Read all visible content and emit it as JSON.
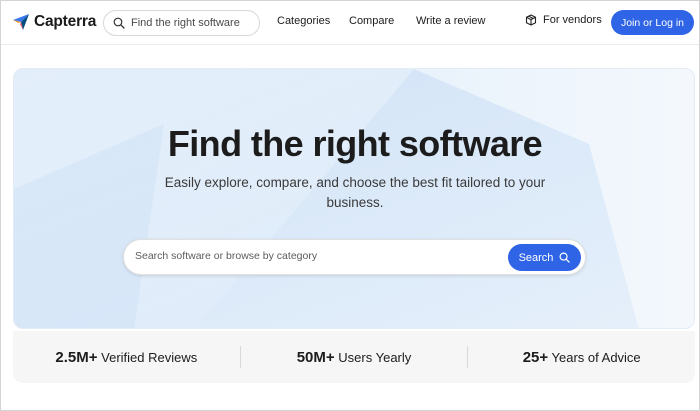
{
  "header": {
    "logo_text": "Capterra",
    "search_placeholder": "Find the right software",
    "nav": [
      "Categories",
      "Compare",
      "Write a review"
    ],
    "vendors_label": "For vendors",
    "join_label": "Join or Log in"
  },
  "hero": {
    "title": "Find the right software",
    "subtitle": "Easily explore, compare, and choose the best fit tailored to your business.",
    "search_placeholder": "Search software or browse by category",
    "search_button": "Search"
  },
  "stats": [
    {
      "value": "2.5M+",
      "label": "Verified Reviews"
    },
    {
      "value": "50M+",
      "label": "Users Yearly"
    },
    {
      "value": "25+",
      "label": "Years of Advice"
    }
  ],
  "colors": {
    "accent": "#2f64e6",
    "logo_blue": "#3a78f0",
    "logo_orange": "#ff9d28",
    "logo_red": "#f2545b",
    "logo_navy": "#044d80"
  },
  "icons": {
    "logo": "capterra-arrow-icon",
    "header_search": "search-icon",
    "vendors": "cube-icon",
    "hero_search": "search-icon"
  }
}
